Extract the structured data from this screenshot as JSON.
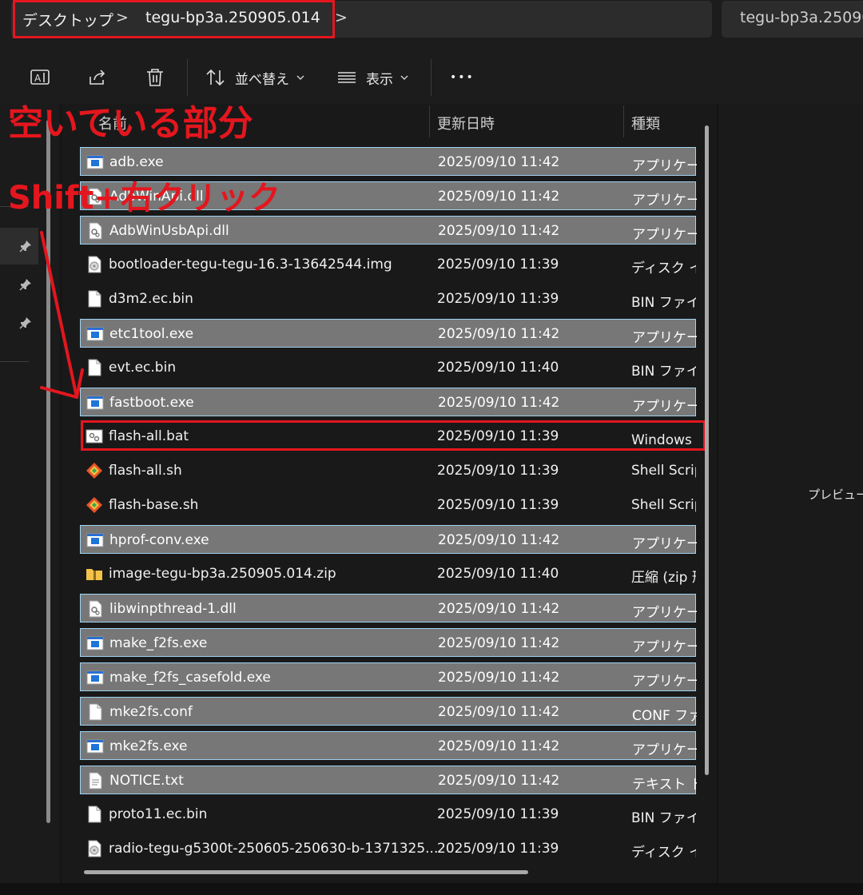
{
  "address_bar": {
    "crumbs": [
      "デスクトップ",
      "tegu-bp3a.250905.014"
    ],
    "separator": ">",
    "search_placeholder": "tegu-bp3a.25090"
  },
  "toolbar": {
    "sort_label": "並べ替え",
    "view_label": "表示",
    "more_label": "•••"
  },
  "columns": {
    "name": "名前",
    "date": "更新日時",
    "type": "種類"
  },
  "files": [
    {
      "name": "adb.exe",
      "date": "2025/09/10 11:42",
      "type": "アプリケーション",
      "icon": "app-icon",
      "selected": true
    },
    {
      "name": "AdbWinApi.dll",
      "date": "2025/09/10 11:42",
      "type": "アプリケーション",
      "icon": "dll-icon",
      "selected": true
    },
    {
      "name": "AdbWinUsbApi.dll",
      "date": "2025/09/10 11:42",
      "type": "アプリケーション",
      "icon": "dll-icon",
      "selected": true
    },
    {
      "name": "bootloader-tegu-tegu-16.3-13642544.img",
      "date": "2025/09/10 11:39",
      "type": "ディスク イメージ",
      "icon": "disk-image-icon",
      "selected": false
    },
    {
      "name": "d3m2.ec.bin",
      "date": "2025/09/10 11:39",
      "type": "BIN ファイル",
      "icon": "file-icon",
      "selected": false
    },
    {
      "name": "etc1tool.exe",
      "date": "2025/09/10 11:42",
      "type": "アプリケーション",
      "icon": "app-icon",
      "selected": true
    },
    {
      "name": "evt.ec.bin",
      "date": "2025/09/10 11:40",
      "type": "BIN ファイル",
      "icon": "file-icon",
      "selected": false
    },
    {
      "name": "fastboot.exe",
      "date": "2025/09/10 11:42",
      "type": "アプリケーション",
      "icon": "app-icon",
      "selected": true
    },
    {
      "name": "flash-all.bat",
      "date": "2025/09/10 11:39",
      "type": "Windows バッチ ファイル",
      "icon": "batch-file-icon",
      "selected": false
    },
    {
      "name": "flash-all.sh",
      "date": "2025/09/10 11:39",
      "type": "Shell Script",
      "icon": "shell-script-icon",
      "selected": false
    },
    {
      "name": "flash-base.sh",
      "date": "2025/09/10 11:39",
      "type": "Shell Script",
      "icon": "shell-script-icon",
      "selected": false
    },
    {
      "name": "hprof-conv.exe",
      "date": "2025/09/10 11:42",
      "type": "アプリケーション",
      "icon": "app-icon",
      "selected": true
    },
    {
      "name": "image-tegu-bp3a.250905.014.zip",
      "date": "2025/09/10 11:40",
      "type": "圧縮 (zip 形式)",
      "icon": "zip-folder-icon",
      "selected": false
    },
    {
      "name": "libwinpthread-1.dll",
      "date": "2025/09/10 11:42",
      "type": "アプリケーション",
      "icon": "dll-icon",
      "selected": true
    },
    {
      "name": "make_f2fs.exe",
      "date": "2025/09/10 11:42",
      "type": "アプリケーション",
      "icon": "app-icon",
      "selected": true
    },
    {
      "name": "make_f2fs_casefold.exe",
      "date": "2025/09/10 11:42",
      "type": "アプリケーション",
      "icon": "app-icon",
      "selected": true
    },
    {
      "name": "mke2fs.conf",
      "date": "2025/09/10 11:42",
      "type": "CONF ファイル",
      "icon": "file-icon",
      "selected": true
    },
    {
      "name": "mke2fs.exe",
      "date": "2025/09/10 11:42",
      "type": "アプリケーション",
      "icon": "app-icon",
      "selected": true
    },
    {
      "name": "NOTICE.txt",
      "date": "2025/09/10 11:42",
      "type": "テキスト ドキュメント",
      "icon": "text-file-icon",
      "selected": true
    },
    {
      "name": "proto11.ec.bin",
      "date": "2025/09/10 11:39",
      "type": "BIN ファイル",
      "icon": "file-icon",
      "selected": false
    },
    {
      "name": "radio-tegu-g5300t-250605-250630-b-1371325...",
      "date": "2025/09/10 11:39",
      "type": "ディスク イメージ",
      "icon": "disk-image-icon",
      "selected": false
    }
  ],
  "preview": {
    "text": "プレビューを"
  },
  "annotations": {
    "empty_area": "空いている部分",
    "shift_right_click": "Shift+右クリック"
  },
  "colors": {
    "highlight_red": "#e4161e",
    "selection_fill": "#777777",
    "selection_border": "#9fd3f2",
    "background": "#191919"
  }
}
